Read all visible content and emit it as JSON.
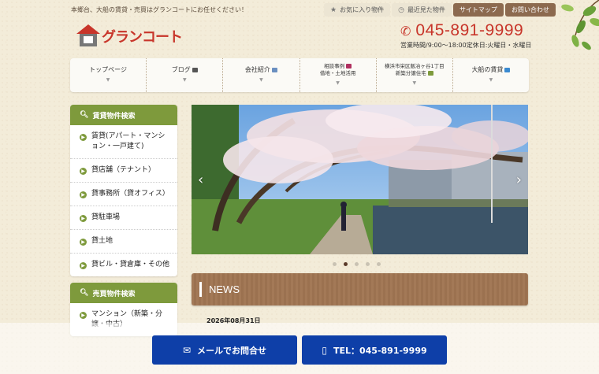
{
  "header": {
    "tagline": "本郷台、大船の賃貸・売買はグランコートにお任せください！",
    "links": [
      {
        "label": "お気に入り物件",
        "icon": "star-icon"
      },
      {
        "label": "最近見た物件",
        "icon": "clock-icon"
      },
      {
        "label": "サイトマップ"
      },
      {
        "label": "お問い合わせ"
      }
    ],
    "logo_text": "グランコート",
    "phone": "045-891-9999",
    "hours": "営業時間/9:00～18:00定休日:火曜日・水曜日"
  },
  "nav": {
    "items": [
      {
        "label": "トップページ"
      },
      {
        "label": "ブログ"
      },
      {
        "label": "会社紹介"
      },
      {
        "label1": "相談事例",
        "label2": "借地・土地活用"
      },
      {
        "label1": "横浜市栄区飯冶ヶ谷1丁目",
        "label2": "新築分譲住宅"
      },
      {
        "label": "大船の賃貸"
      }
    ]
  },
  "sidebar": {
    "rent": {
      "title": "賃貸物件検索",
      "items": [
        "賃貸(アパート・マンション・一戸建て)",
        "貸店舗（テナント）",
        "貸事務所（貸オフィス）",
        "貸駐車場",
        "貸土地",
        "貸ビル・貸倉庫・その他"
      ]
    },
    "sale": {
      "title": "売買物件検索",
      "items": [
        "マンション（新築・分譲・中古）"
      ]
    }
  },
  "slider": {
    "active_index": 1,
    "count": 5
  },
  "news": {
    "title": "NEWS",
    "first_date": "2026年08月31日"
  },
  "cta": {
    "mail_label": "メールでお問合せ",
    "tel_label": "TEL：045-891-9999"
  },
  "colors": {
    "accent_red": "#c8352a",
    "sidebar_green": "#7e9a3c",
    "cta_blue": "#0e3fa8",
    "news_brown": "#a07552"
  }
}
